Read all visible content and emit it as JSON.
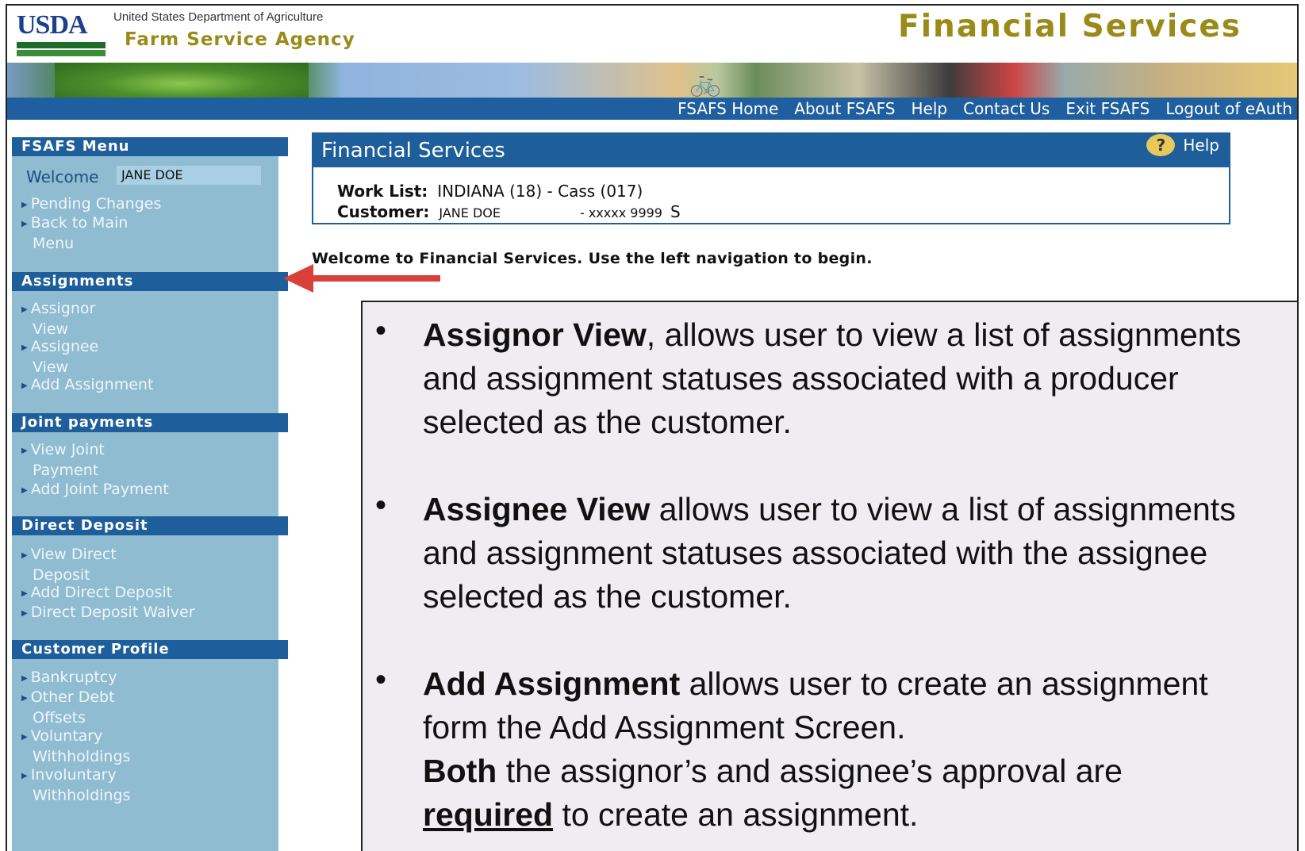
{
  "header": {
    "logo_text": "USDA",
    "department": "United States Department of Agriculture",
    "agency": "Farm Service Agency",
    "app_title": "Financial Services"
  },
  "nav": {
    "links": [
      "FSAFS Home",
      "About FSAFS",
      "Help",
      "Contact Us",
      "Exit FSAFS",
      "Logout of eAuth"
    ]
  },
  "sidebar": {
    "menu_title": "FSAFS Menu",
    "welcome_label": "Welcome",
    "user_name": "JANE DOE",
    "menu_items": [
      "Pending Changes",
      "Back to Main",
      "Menu"
    ],
    "sections": [
      {
        "title": "Assignments",
        "items": [
          "Assignor",
          "View",
          "Assignee",
          "View",
          "Add Assignment"
        ]
      },
      {
        "title": "Joint payments",
        "items": [
          "View Joint",
          "Payment",
          "Add Joint Payment"
        ]
      },
      {
        "title": "Direct Deposit",
        "items": [
          "View Direct",
          "Deposit",
          "Add Direct Deposit",
          "Direct Deposit Waiver"
        ]
      },
      {
        "title": "Customer Profile",
        "items": [
          "Bankruptcy",
          "Other Debt",
          "Offsets",
          "Voluntary",
          "Withholdings",
          "Involuntary",
          "Withholdings"
        ]
      }
    ]
  },
  "panel": {
    "title": "Financial Services",
    "help_label": "Help",
    "help_icon": "?",
    "work_list_label": "Work List:",
    "work_list_value": "INDIANA (18) - Cass (017)",
    "customer_label": "Customer:",
    "customer_name": "JANE DOE",
    "customer_id": "- xxxxx 9999",
    "customer_type": "S"
  },
  "welcome_message": "Welcome to Financial Services. Use the left navigation to begin.",
  "callout": {
    "b1_bold": "Assignor View",
    "b1_text": ", allows user to view a list of assignments and assignment statuses associated with a producer selected as the customer.",
    "b2_bold": "Assignee View",
    "b2_text": " allows user to view a list of assignments and assignment statuses associated with the assignee selected as the customer.",
    "b3_bold": "Add Assignment",
    "b3_text": " allows user to create an assignment form the Add Assignment Screen.",
    "b3_bold2": "Both",
    "b3_text2": " the assignor’s and assignee’s approval are",
    "b3_bold3": "required",
    "b3_text3": " to create an assignment.",
    "bullet_char": "•"
  },
  "colors": {
    "nav_blue": "#1f5fa0",
    "sidebar_bg": "#90bcd2",
    "gold": "#9a8a1a",
    "arrow_red": "#d9403a"
  }
}
